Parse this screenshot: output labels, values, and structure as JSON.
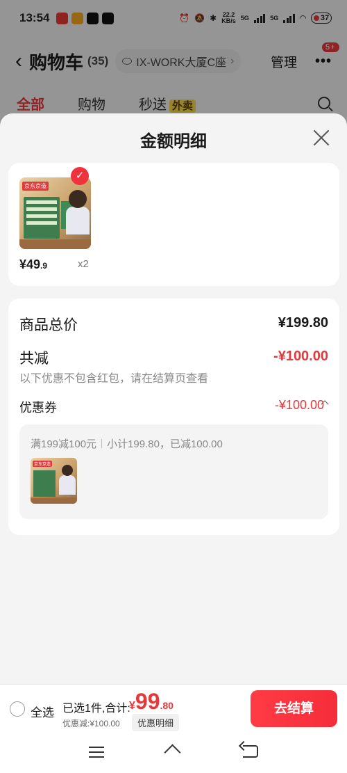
{
  "status_bar": {
    "time": "13:54",
    "net_speed": "22.2",
    "net_unit": "KB/s",
    "sim1": "5G",
    "sim2": "5G",
    "battery": "37"
  },
  "nav": {
    "title": "购物车",
    "count": "(35)",
    "location": "IX-WORK大厦C座",
    "manage": "管理",
    "badge": "5+"
  },
  "tabs": [
    {
      "label": "全部",
      "active": true
    },
    {
      "label": "购物"
    },
    {
      "label": "秒送"
    }
  ],
  "tab_tag": "外卖",
  "sheet": {
    "title": "金额明细"
  },
  "product": {
    "brand": "京东京造",
    "price_int": "¥49",
    "price_dec": ".9",
    "qty": "x2"
  },
  "summary": {
    "total_label": "商品总价",
    "total_value": "¥199.80",
    "reduce_label": "共减",
    "reduce_value": "-¥100.00",
    "note": "以下优惠不包含红包，请在结算页查看",
    "coupon_label": "优惠券",
    "coupon_value": "-¥100.00",
    "coupon_rule": "满199减100元",
    "coupon_detail": "小计199.80，已减100.00"
  },
  "checkout": {
    "select_all": "全选",
    "selected_info": "已选1件,合计:",
    "currency": "¥",
    "total_int": "99",
    "total_dec": ".80",
    "discount_info": "优惠减:¥100.00",
    "detail_chip": "优惠明细",
    "button": "去结算"
  },
  "colors": {
    "accent": "#e4393c",
    "button": "#f52d3a"
  }
}
